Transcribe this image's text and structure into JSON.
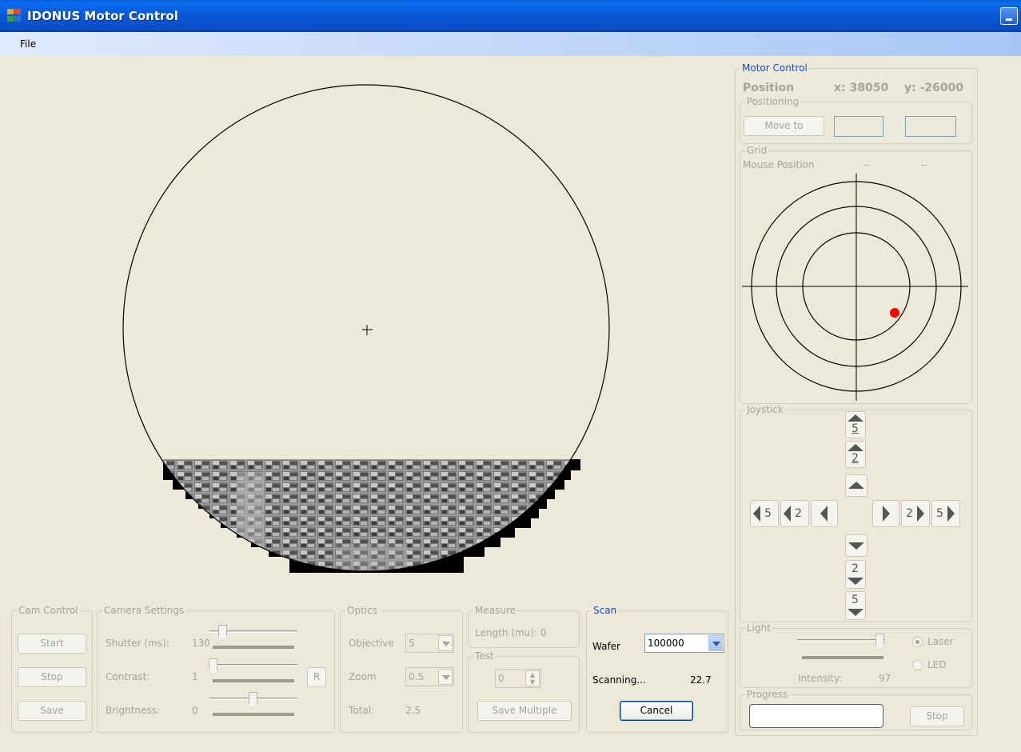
{
  "window": {
    "title": "IDONUS Motor Control"
  },
  "menu": {
    "file": "File"
  },
  "motor_control": {
    "legend": "Motor Control",
    "position_label": "Position",
    "x_text": "x: 38050",
    "y_text": "y: -26000",
    "positioning": {
      "legend": "Positioning",
      "move_to": "Move to"
    },
    "grid": {
      "legend": "Grid",
      "mouse_position_label": "Mouse Position",
      "mouse_x": "--",
      "mouse_y": "--"
    },
    "joystick": {
      "legend": "Joystick",
      "up5": "5",
      "up2": "2",
      "down2": "2",
      "down5": "5",
      "left5": "5",
      "left2": "2",
      "right2": "2",
      "right5": "5"
    },
    "light": {
      "legend": "Light",
      "intensity_label": "Intensity:",
      "intensity_value": "97",
      "intensity_level": 0.97,
      "laser": "Laser",
      "led": "LED"
    },
    "progress": {
      "legend": "Progress",
      "stop": "Stop"
    }
  },
  "cam_control": {
    "legend": "Cam Control",
    "start": "Start",
    "stop": "Stop",
    "save": "Save"
  },
  "camera_settings": {
    "legend": "Camera Settings",
    "shutter_label": "Shutter (ms):",
    "shutter_value": "130",
    "contrast_label": "Contrast:",
    "contrast_value": "1",
    "reset": "R",
    "brightness_label": "Brightness:",
    "brightness_value": "0"
  },
  "optics": {
    "legend": "Optics",
    "objective_label": "Objective",
    "objective_value": "5",
    "zoom_label": "Zoom",
    "zoom_value": "0.5",
    "total_label": "Total:",
    "total_value": "2.5"
  },
  "measure": {
    "legend": "Measure",
    "length_text": "Length (mu): 0"
  },
  "test": {
    "legend": "Test",
    "value": "0",
    "save_multiple": "Save Multiple"
  },
  "scan": {
    "legend": "Scan",
    "wafer_label": "Wafer",
    "wafer_value": "100000",
    "status": "Scanning...",
    "status_value": "22.7",
    "cancel": "Cancel"
  },
  "colors": {
    "marker": "#ff0000",
    "title_blue": "#0a5fd8",
    "panel": "#ece9d8"
  },
  "icons": {
    "app": "app-icon",
    "crosshair": "crosshair-icon"
  }
}
